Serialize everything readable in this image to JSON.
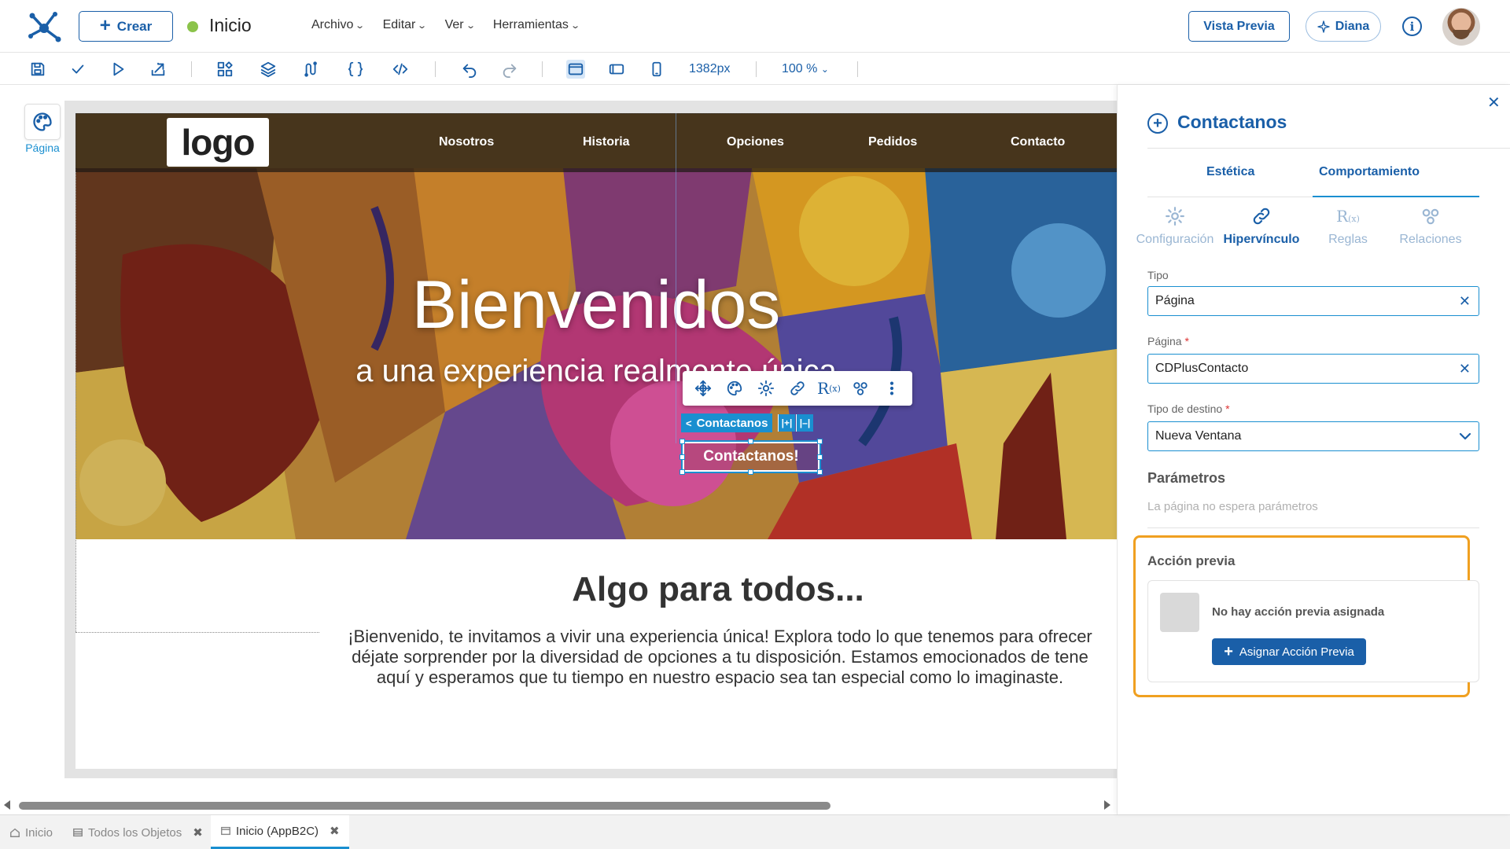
{
  "topbar": {
    "create_label": "Crear",
    "page_name": "Inicio",
    "status_color": "#8bc34a",
    "menu": [
      {
        "label": "Archivo"
      },
      {
        "label": "Editar"
      },
      {
        "label": "Ver"
      },
      {
        "label": "Herramientas"
      }
    ],
    "preview_label": "Vista Previa",
    "assistant_label": "Diana"
  },
  "toolbar": {
    "icons": [
      "save-icon",
      "check-icon",
      "play-icon",
      "export-icon",
      "components-icon",
      "layers-icon",
      "data-flow-icon",
      "braces-icon",
      "code-icon",
      "undo-icon",
      "redo-icon",
      "desktop-view-icon",
      "tablet-view-icon",
      "mobile-view-icon"
    ],
    "width_value": "1382px",
    "zoom_value": "100 %"
  },
  "left_rail": {
    "page_label": "Página"
  },
  "site": {
    "logo_text": "logo",
    "nav": [
      "Nosotros",
      "Historia",
      "Opciones",
      "Pedidos",
      "Contacto"
    ],
    "hero_title": "Bienvenidos",
    "hero_subtitle": "a una experiencia realmente única",
    "button_label": "Contactanos!",
    "card_title": "Algo para todos...",
    "card_text_lines": [
      "¡Bienvenido, te invitamos a vivir una experiencia única! Explora todo lo que tenemos para ofrecer",
      "déjate sorprender por la diversidad de opciones a tu disposición. Estamos emocionados de tene",
      "aquí y esperamos que tu tiempo en nuestro espacio sea tan especial como lo imaginaste."
    ]
  },
  "selection": {
    "element_name": "Contactanos",
    "toolbar_icons": [
      "move-icon",
      "palette-icon",
      "settings-icon",
      "link-icon",
      "rules-icon",
      "relations-icon",
      "more-icon"
    ],
    "rules_glyph": "R",
    "rules_sub": "(x)",
    "mini_a": "|+|",
    "mini_b": "|–|"
  },
  "bottom_tabs": [
    {
      "label": "Inicio",
      "closable": false,
      "active": false
    },
    {
      "label": "Todos los Objetos",
      "closable": true,
      "active": false
    },
    {
      "label": "Inicio (AppB2C)",
      "closable": true,
      "active": true
    }
  ],
  "panel": {
    "title": "Contactanos",
    "tabs": [
      "Estética",
      "Comportamiento"
    ],
    "active_tab": "Comportamiento",
    "sub_tabs": [
      {
        "label": "Configuración",
        "icon": "gear-icon",
        "active": false
      },
      {
        "label": "Hipervínculo",
        "icon": "link-icon",
        "active": true
      },
      {
        "label": "Reglas",
        "icon": "rules-icon",
        "active": false
      },
      {
        "label": "Relaciones",
        "icon": "relations-icon",
        "active": false
      }
    ],
    "tipo_label": "Tipo",
    "tipo_value": "Página",
    "pagina_label": "Página",
    "pagina_value": "CDPlusContacto",
    "destino_label": "Tipo de destino",
    "destino_value": "Nueva Ventana",
    "required_mark": "*",
    "params_title": "Parámetros",
    "params_text": "La página no espera parámetros",
    "accion_title": "Acción previa",
    "accion_msg": "No hay acción previa asignada",
    "accion_button": "Asignar Acción Previa",
    "highlight_color": "#f0a020",
    "accent_color": "#1a5fa8"
  }
}
